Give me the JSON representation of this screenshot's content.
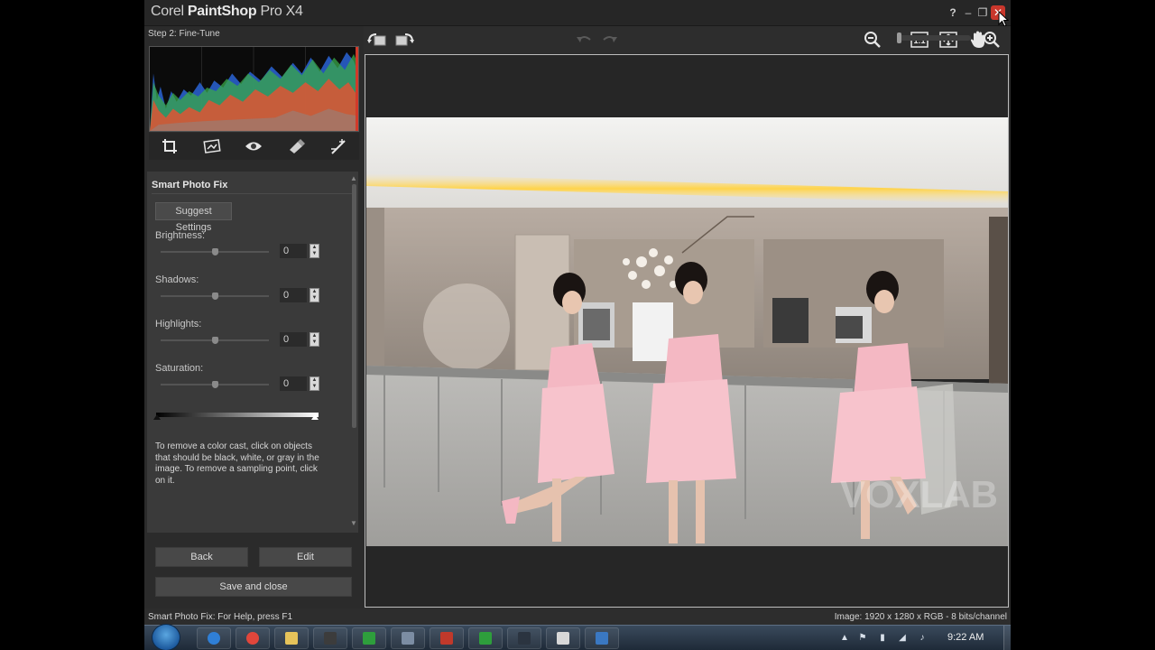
{
  "window": {
    "title_prefix": "Corel ",
    "title_bold": "PaintShop",
    "title_suffix": " Pro X4",
    "help_label": "?",
    "minimize_label": "‒",
    "restore_label": "❐",
    "close_label": "✕"
  },
  "panel": {
    "step_label": "Step 2: Fine-Tune",
    "section_title": "Smart Photo Fix",
    "suggest_label": "Suggest Settings",
    "sliders": [
      {
        "label": "Brightness:",
        "value": "0",
        "level": 0.5
      },
      {
        "label": "Shadows:",
        "value": "0",
        "level": 0.5
      },
      {
        "label": "Highlights:",
        "value": "0",
        "level": 0.5
      },
      {
        "label": "Saturation:",
        "value": "0",
        "level": 0.5
      }
    ],
    "instructions": "To remove a color cast, click on objects that should be black, white, or gray in the image. To remove a sampling point, click on it.",
    "back_label": "Back",
    "edit_label": "Edit",
    "save_label": "Save and close"
  },
  "tool_icons": [
    "crop-icon",
    "straighten-icon",
    "red-eye-icon",
    "retouch-brush-icon",
    "adjust-icon"
  ],
  "toolbar_icons": [
    "rotate-left-icon",
    "rotate-right-icon",
    "undo-icon",
    "redo-icon",
    "actual-size-icon",
    "fit-window-icon",
    "pan-hand-icon",
    "zoom-out-icon",
    "zoom-in-icon"
  ],
  "zoom_level": 0.0,
  "watermark": "VOXLAB",
  "status": {
    "left": "Smart Photo Fix: For Help, press F1",
    "right": "Image:  1920 x 1280 x RGB - 8 bits/channel"
  },
  "taskbar": {
    "apps": [
      "internet-explorer",
      "chrome",
      "file-explorer",
      "terminal",
      "excel",
      "media-player",
      "stop-app",
      "excel-2",
      "console",
      "pdf-reader",
      "paintshop"
    ],
    "app_colors": [
      "#2f7fd6",
      "#e1463b",
      "#e6c35a",
      "#3c3c3c",
      "#2e9e3c",
      "#7c8da3",
      "#c0392b",
      "#2e9e3c",
      "#2b3440",
      "#d8d8d8",
      "#3a78c2"
    ],
    "clock": "9:22 AM"
  },
  "colors": {
    "accent_close": "#c9372c",
    "panel_bg": "#2b2b2b",
    "section_bg": "#3a3a3a"
  }
}
